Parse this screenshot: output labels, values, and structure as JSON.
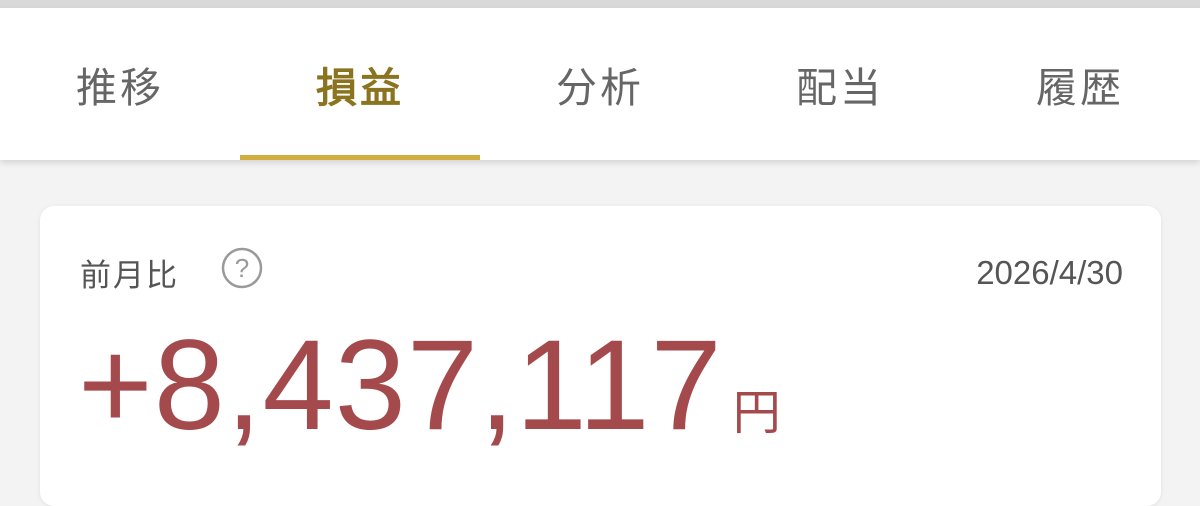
{
  "tabs": [
    {
      "label": "推移",
      "active": false
    },
    {
      "label": "損益",
      "active": true
    },
    {
      "label": "分析",
      "active": false
    },
    {
      "label": "配当",
      "active": false
    },
    {
      "label": "履歴",
      "active": false
    }
  ],
  "summary": {
    "label": "前月比",
    "help_icon": "question-circle-icon",
    "date": "2026/4/30",
    "amount": "+8,437,117",
    "unit": "円"
  },
  "colors": {
    "accent": "#d1ae3d",
    "active_tab_text": "#8a7420",
    "positive_amount": "#a44a4d",
    "background": "#f3f3f3"
  }
}
